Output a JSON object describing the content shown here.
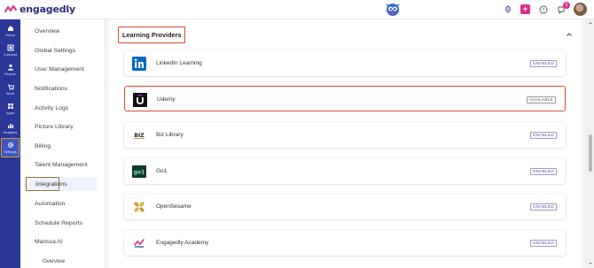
{
  "header": {
    "brand": "engagedly",
    "notification_count": "6"
  },
  "rail": [
    {
      "label": "Home",
      "icon": "home-icon"
    },
    {
      "label": "Connect",
      "icon": "connect-icon"
    },
    {
      "label": "People",
      "icon": "people-icon"
    },
    {
      "label": "Store",
      "icon": "store-icon"
    },
    {
      "label": "Apps",
      "icon": "apps-icon"
    },
    {
      "label": "Analytics",
      "icon": "analytics-icon"
    },
    {
      "label": "Settings",
      "icon": "gear-icon",
      "active": true
    }
  ],
  "subnav": {
    "items": [
      "Overview",
      "Global Settings",
      "User Management",
      "Notifications",
      "Activity Logs",
      "Picture Library",
      "Billing",
      "Talent Management",
      "Integrations",
      "Automation",
      "Schedule Reports",
      "Marissa AI",
      "Overview"
    ],
    "active": "Integrations"
  },
  "section": {
    "title": "Learning Providers"
  },
  "providers": [
    {
      "name": "LinkedIn Learning",
      "status": "ENABLED"
    },
    {
      "name": "Udemy",
      "status": "AVAILABLE"
    },
    {
      "name": "Biz Library",
      "status": "ENABLED",
      "logo_text": "BIZ"
    },
    {
      "name": "Go1",
      "status": "ENABLED",
      "logo_text": "go1"
    },
    {
      "name": "OpenSesame",
      "status": "ENABLED"
    },
    {
      "name": "Engagedly Academy",
      "status": "ENABLED"
    }
  ],
  "colors": {
    "rail_bg": "#2a3698",
    "accent_pink": "#e02e8b",
    "highlight_red": "#e04a2e",
    "active_border": "#8c7a34"
  }
}
